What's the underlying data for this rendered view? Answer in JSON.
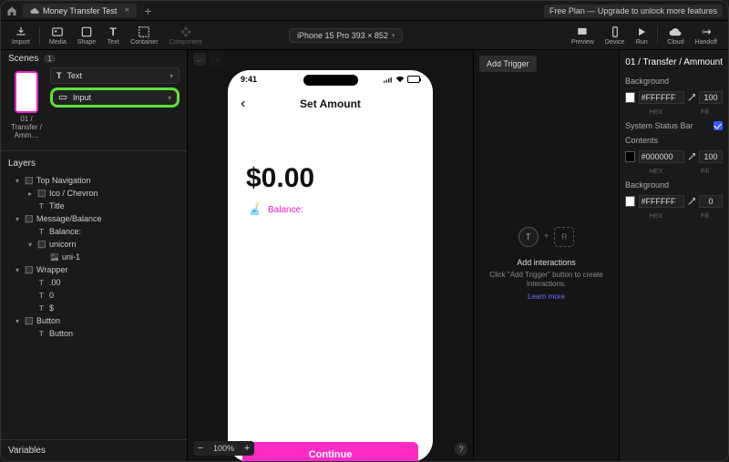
{
  "titlebar": {
    "tab_title": "Money Transfer Test",
    "free_plan": "Free Plan — Upgrade to unlock more features"
  },
  "toolbar": {
    "import": "Import",
    "media": "Media",
    "shape": "Shape",
    "text": "Text",
    "container": "Container",
    "component": "Component",
    "device": "iPhone 15 Pro  393 × 852",
    "preview": "Preview",
    "device_btn": "Device",
    "run": "Run",
    "cloud": "Cloud",
    "handoff": "Handoff"
  },
  "scenes": {
    "label": "Scenes",
    "count": "1",
    "thumb_label": "01 / Transfer / Amm…",
    "dropdown_text": "Text",
    "dropdown_input": "Input"
  },
  "layers": {
    "label": "Layers",
    "items": [
      {
        "depth": 0,
        "expand": "▾",
        "icon": "dashed",
        "label": "Top Navigation"
      },
      {
        "depth": 1,
        "expand": "▸",
        "icon": "dashed",
        "label": "Ico / Chevron"
      },
      {
        "depth": 1,
        "expand": "",
        "icon": "T",
        "label": "Title"
      },
      {
        "depth": 0,
        "expand": "▾",
        "icon": "dashed",
        "label": "Message/Balance"
      },
      {
        "depth": 1,
        "expand": "",
        "icon": "T",
        "label": "Balance:"
      },
      {
        "depth": 1,
        "expand": "▾",
        "icon": "dashed",
        "label": "unicorn"
      },
      {
        "depth": 2,
        "expand": "",
        "icon": "img",
        "label": "uni-1"
      },
      {
        "depth": 0,
        "expand": "▾",
        "icon": "dashed",
        "label": "Wrapper"
      },
      {
        "depth": 1,
        "expand": "",
        "icon": "T",
        "label": ".00"
      },
      {
        "depth": 1,
        "expand": "",
        "icon": "T",
        "label": "0"
      },
      {
        "depth": 1,
        "expand": "",
        "icon": "T",
        "label": "$"
      },
      {
        "depth": 0,
        "expand": "▾",
        "icon": "dashed",
        "label": "Button"
      },
      {
        "depth": 1,
        "expand": "",
        "icon": "T",
        "label": "Button"
      }
    ]
  },
  "variables": {
    "label": "Variables"
  },
  "canvas": {
    "zoom": "100%"
  },
  "phone": {
    "time": "9:41",
    "page_title": "Set Amount",
    "amount": "$0.00",
    "balance_label": "Balance:",
    "continue": "Continue"
  },
  "interactions": {
    "add_trigger": "Add Trigger",
    "t": "T",
    "plus": "+",
    "r": "R",
    "title": "Add interactions",
    "sub": "Click \"Add Trigger\" button to create Interactions.",
    "learn": "Learn more"
  },
  "inspector": {
    "heading": "01 / Transfer / Ammount",
    "background": "Background",
    "bg_hex": "#FFFFFF",
    "bg_fill": "100",
    "hex_label": "HEX",
    "fill_label": "Fill",
    "status": "System Status Bar",
    "contents": "Contents",
    "contents_hex": "#000000",
    "contents_fill": "100",
    "background2": "Background",
    "bg2_hex": "#FFFFFF",
    "bg2_fill": "0"
  }
}
